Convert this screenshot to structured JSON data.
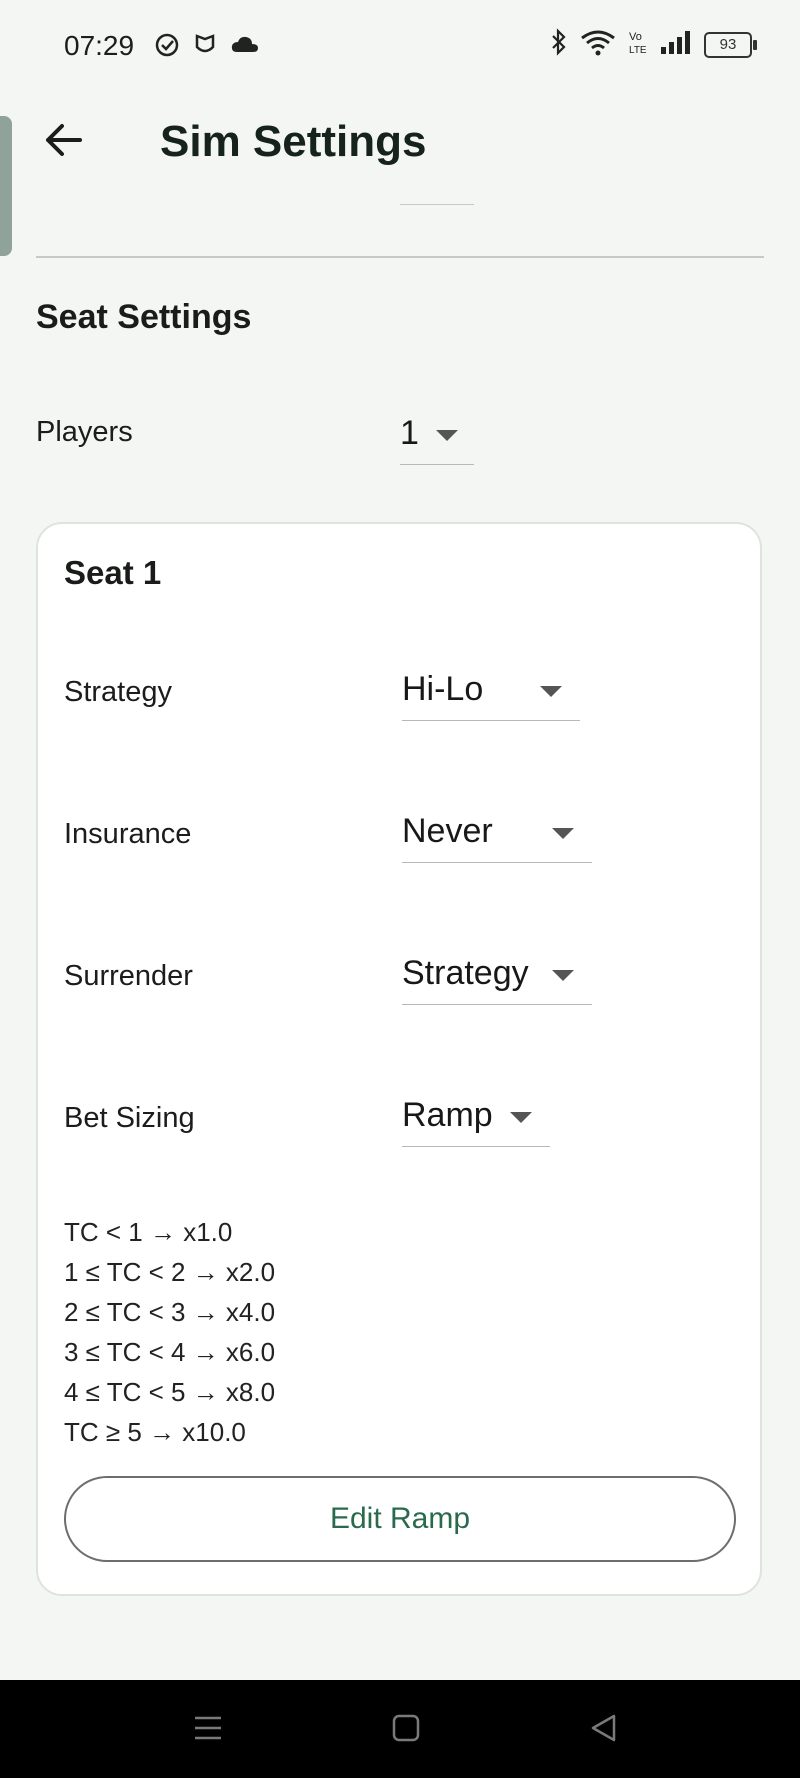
{
  "status_bar": {
    "time": "07:29",
    "left_icons": [
      "check-circle-icon",
      "shield-icon",
      "cloud-icon"
    ],
    "right_icons": [
      "bluetooth-icon",
      "wifi-icon",
      "volte-icon",
      "signal-icon"
    ],
    "battery": "93"
  },
  "app_bar": {
    "back_icon": "arrow-back-icon",
    "title": "Sim Settings"
  },
  "seat_settings": {
    "title": "Seat Settings",
    "players_label": "Players",
    "players_value": "1"
  },
  "seat": {
    "title": "Seat 1",
    "rows": [
      {
        "label": "Strategy",
        "value": "Hi-Lo"
      },
      {
        "label": "Insurance",
        "value": "Never"
      },
      {
        "label": "Surrender",
        "value": "Strategy"
      },
      {
        "label": "Bet Sizing",
        "value": "Ramp"
      }
    ],
    "ramp": [
      "TC < 1 → x1.0",
      "1 ≤ TC < 2 → x2.0",
      "2 ≤ TC < 3 → x4.0",
      "3 ≤ TC < 4 → x6.0",
      "4 ≤ TC < 5 → x8.0",
      "TC ≥ 5 → x10.0"
    ],
    "edit_button": "Edit Ramp"
  },
  "nav_bar": {
    "icons": [
      "menu-icon",
      "home-icon",
      "back-triangle-icon"
    ]
  },
  "colors": {
    "background": "#f4f6f3",
    "accent_text": "#2a6a4c",
    "title_text": "#16231c"
  }
}
